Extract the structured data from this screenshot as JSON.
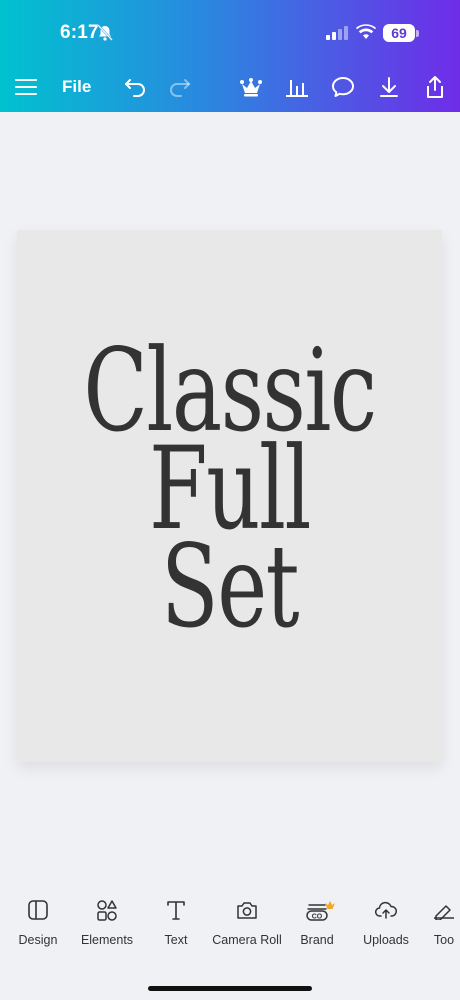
{
  "status_bar": {
    "time": "6:17",
    "battery": "69"
  },
  "toolbar": {
    "file_label": "File",
    "icons": [
      "menu-icon",
      "undo-icon",
      "redo-icon",
      "crown-icon",
      "chart-icon",
      "comment-icon",
      "download-icon",
      "share-icon"
    ]
  },
  "canvas": {
    "lines": [
      "Classic",
      "Full",
      "Set"
    ],
    "background": "#e8e8e8",
    "text_color": "#333333"
  },
  "bottom_nav": {
    "items": [
      {
        "label": "Design",
        "icon": "design-icon"
      },
      {
        "label": "Elements",
        "icon": "elements-icon"
      },
      {
        "label": "Text",
        "icon": "text-icon"
      },
      {
        "label": "Camera Roll",
        "icon": "camera-icon"
      },
      {
        "label": "Brand",
        "icon": "brand-icon"
      },
      {
        "label": "Uploads",
        "icon": "upload-cloud-icon"
      },
      {
        "label": "Too",
        "icon": "tools-icon"
      }
    ]
  },
  "colors": {
    "gradient_start": "#00c2cf",
    "gradient_end": "#6f2ce8",
    "page_bg": "#f0f1f5",
    "crown_accent": "#f5a623"
  }
}
